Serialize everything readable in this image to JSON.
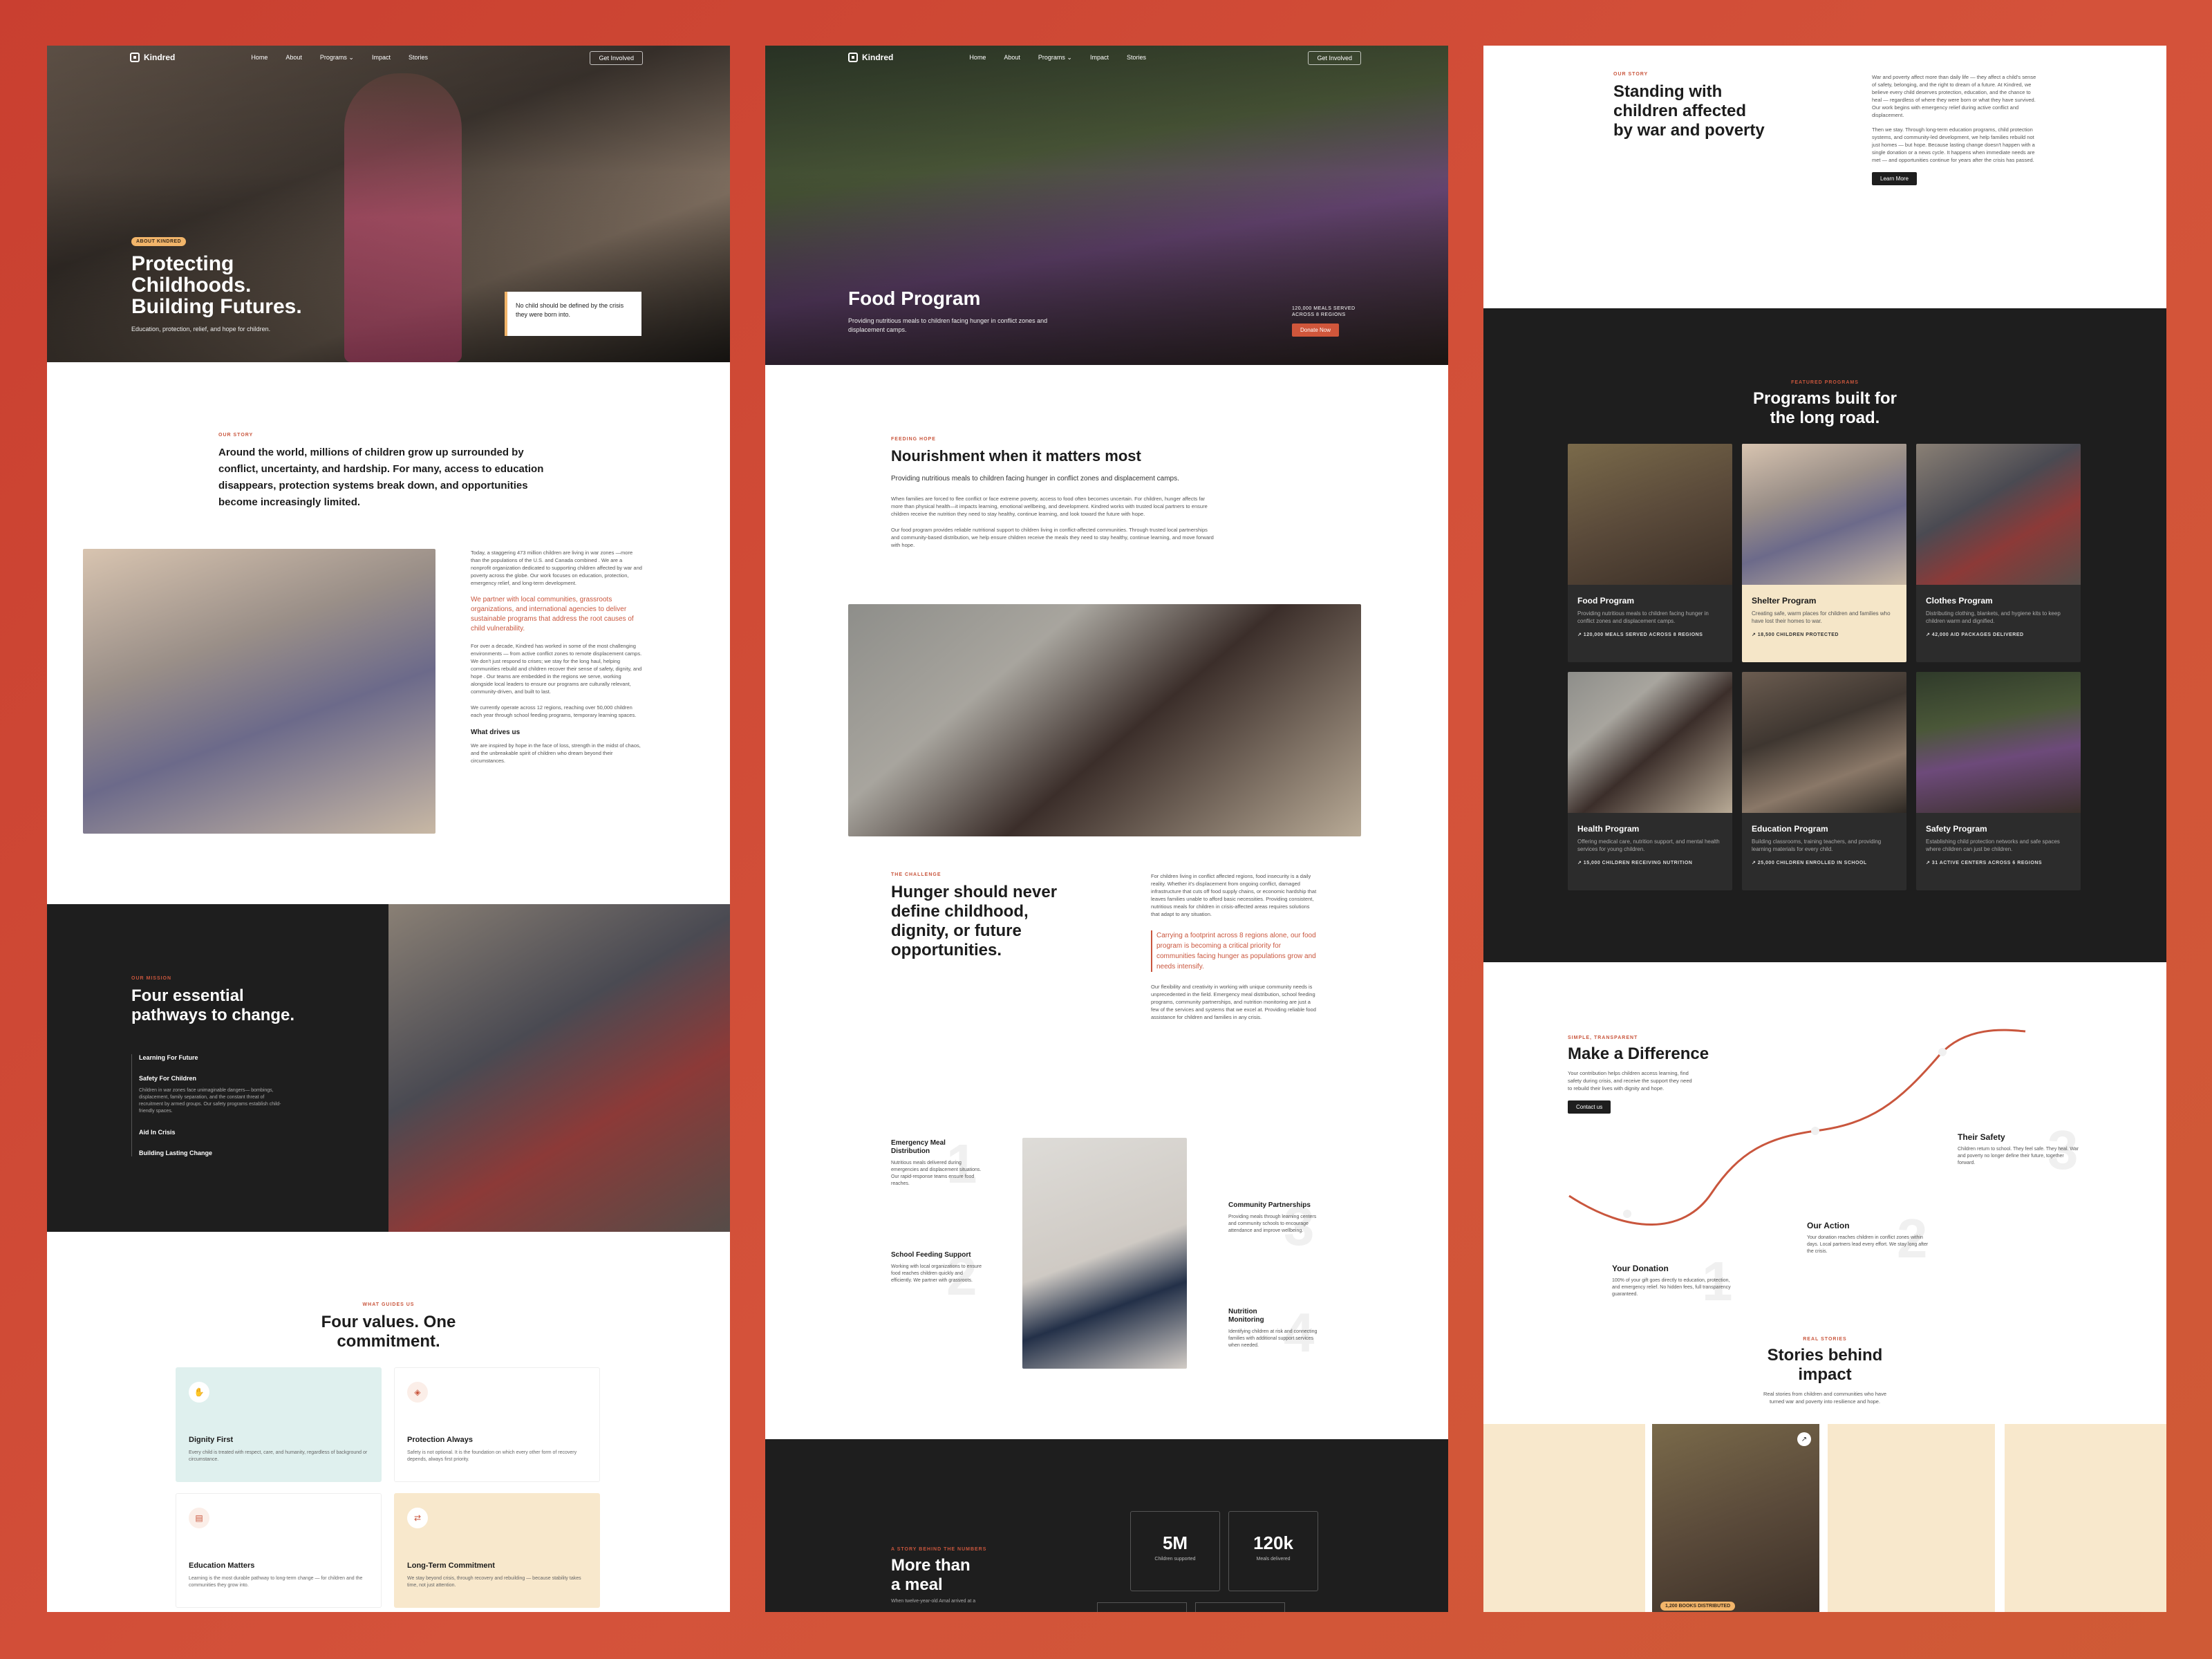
{
  "frame1": {
    "nav": {
      "logo": "Kindred",
      "links": [
        "Home",
        "About",
        "Programs",
        "Impact",
        "Stories"
      ],
      "cta": "Get Involved"
    },
    "hero": {
      "tag": "ABOUT KINDRED",
      "title_l1": "Protecting",
      "title_l2": "Childhoods.",
      "title_l3": "Building Futures.",
      "subtitle": "Education, protection, relief, and hope for children.",
      "quote": "No child should be defined by the crisis they were born into."
    },
    "story": {
      "eyebrow": "OUR STORY",
      "lead": "Around the world, millions of children grow up surrounded by conflict, uncertainty, and hardship. For many, access to education disappears, protection systems break down, and opportunities become increasingly limited.",
      "p1": "Today, a staggering 473 million children are living in war zones —more than the populations of the U.S. and Canada combined . We are a nonprofit organization dedicated to supporting children affected by war and poverty across the globe. Our work focuses on education, protection, emergency relief, and long-term development.",
      "highlight": "We partner with local communities, grassroots organizations, and international agencies to deliver sustainable programs that address the root causes of child vulnerability.",
      "p2": "For over a decade, Kindred has worked in some of the most challenging environments — from active conflict zones to remote displacement camps. We don't just respond to crises; we stay for the long haul, helping communities rebuild and children recover their sense of safety, dignity, and hope . Our teams are embedded in the regions we serve, working alongside local leaders to ensure our programs are culturally relevant, community-driven, and built to last.",
      "p3": "We currently operate across 12 regions, reaching over 50,000 children each year through school feeding programs, temporary learning spaces.",
      "drives_title": "What drives us",
      "p4": "We are inspired by hope in the face of loss, strength in the midst of chaos, and the unbreakable spirit of children who dream beyond their circumstances."
    },
    "mission": {
      "eyebrow": "OUR MISSION",
      "title_l1": "Four essential",
      "title_l2": "pathways to change.",
      "items": [
        "Learning For Future",
        "Safety For Children",
        "Aid In Crisis",
        "Building Lasting Change"
      ],
      "active_desc": "Children in war zones face unimaginable dangers— bombings, displacement, family separation, and the constant threat of recruitment by armed groups. Our safety programs establish child-friendly spaces."
    },
    "values": {
      "eyebrow": "WHAT GUIDES US",
      "title_l1": "Four values. One",
      "title_l2": "commitment.",
      "cards": [
        {
          "title": "Dignity First",
          "desc": "Every child is treated with respect, care, and humanity, regardless of background or circumstance.",
          "icon": "hand-icon",
          "color": "#dff0ee"
        },
        {
          "title": "Protection Always",
          "desc": "Safety is not optional. It is the foundation on which every other form of recovery depends, always first priority.",
          "icon": "shield-icon",
          "color": "#ffffff"
        },
        {
          "title": "Education Matters",
          "desc": "Learning is the most durable pathway to long-term change — for children and the communities they grow into.",
          "icon": "book-icon",
          "color": "#ffffff"
        },
        {
          "title": "Long-Term Commitment",
          "desc": "We stay beyond crisis, through recovery and rebuilding — because stability takes time, not just attention.",
          "icon": "handshake-icon",
          "color": "#f8e8cc"
        }
      ]
    }
  },
  "frame2": {
    "nav": {
      "logo": "Kindred",
      "links": [
        "Home",
        "About",
        "Programs",
        "Impact",
        "Stories"
      ],
      "cta": "Get Involved"
    },
    "hero": {
      "title": "Food Program",
      "subtitle": "Providing nutritious meals to children facing hunger in conflict zones and displacement camps.",
      "stat": "120,000 MEALS SERVED ACROSS 8 REGIONS",
      "cta": "Donate Now"
    },
    "intro": {
      "eyebrow": "FEEDING HOPE",
      "title": "Nourishment when it matters most",
      "lead": "Providing nutritious meals to children facing hunger in conflict zones and displacement camps.",
      "p1": "When families are forced to flee conflict or face extreme poverty, access to food often becomes uncertain. For children, hunger affects far more than physical health—it impacts learning, emotional wellbeing, and development. Kindred works with trusted local partners to ensure children receive the nutrition they need to stay healthy, continue learning, and look toward the future with hope.",
      "p2": "Our food program provides reliable nutritional support to children living in conflict-affected communities. Through trusted local partnerships and community-based distribution, we help ensure children receive the meals they need to stay healthy, continue learning, and move forward with hope."
    },
    "challenge": {
      "eyebrow": "THE CHALLENGE",
      "title_l1": "Hunger should never",
      "title_l2": "define childhood,",
      "title_l3": "dignity, or future",
      "title_l4": "opportunities.",
      "p1": "For children living in conflict affected regions, food insecurity is a daily reality. Whether it's displacement from ongoing conflict, damaged infrastructure that cuts off food supply chains, or economic hardship that leaves families unable to afford basic necessities. Providing consistent, nutritious meals for children in crisis-affected areas requires solutions that adapt to any situation.",
      "highlight": "Carrying a footprint across 8 regions alone, our food program is becoming a critical priority for communities facing hunger as populations grow and needs intensify.",
      "p2": "Our flexibility and creativity in working with unique community needs is unprecedented in the field. Emergency meal distribution, school feeding programs, community partnerships, and nutrition monitoring are just a few of the services and systems that we excel at. Providing reliable food assistance for children and families in any crisis."
    },
    "steps": [
      {
        "title": "Emergency Meal Distribution",
        "desc": "Nutritious meals delivered during emergencies and displacement situations. Our rapid-response teams ensure food reaches.",
        "num": "1"
      },
      {
        "title": "School Feeding Support",
        "desc": "Working with local organizations to ensure food reaches children quickly and efficiently. We partner with grassroots.",
        "num": "2"
      },
      {
        "title": "Community Partnerships",
        "desc": "Providing meals through learning centers and community schools to encourage attendance and improve wellbeing.",
        "num": "3"
      },
      {
        "title": "Nutrition Monitoring",
        "desc": "Identifying children at risk and connecting families with additional support services when needed.",
        "num": "4"
      }
    ],
    "numbers": {
      "eyebrow": "A STORY BEHIND THE NUMBERS",
      "title_l1": "More than",
      "title_l2": "a meal",
      "desc": "When twelve-year-old Amal arrived at a",
      "stats": [
        {
          "n": "5M",
          "l": "Children supported"
        },
        {
          "n": "120k",
          "l": "Meals delivered"
        }
      ]
    }
  },
  "frame3": {
    "story": {
      "eyebrow": "OUR STORY",
      "title_l1": "Standing with",
      "title_l2": "children affected",
      "title_l3": "by war and poverty",
      "p1": "War and poverty affect more than daily life — they affect a child's sense of safety, belonging, and the right to dream of a future. At Kindred, we believe every child deserves protection, education, and the chance to heal — regardless of where they were born or what they have survived. Our work begins with emergency relief during active conflict and displacement.",
      "p2": "Then we stay. Through long-term education programs, child protection systems, and community-led development, we help families rebuild not just homes — but hope. Because lasting change doesn't happen with a single donation or a news cycle. It happens when immediate needs are met — and opportunities continue for years after the crisis has passed.",
      "cta": "Learn More"
    },
    "programs": {
      "eyebrow": "FEATURED PROGRAMS",
      "title_l1": "Programs built for",
      "title_l2": "the long road.",
      "cards": [
        {
          "title": "Food Program",
          "desc": "Providing nutritious meals to children facing hunger in conflict zones and displacement camps.",
          "stat": "↗ 120,000 MEALS SERVED ACROSS 8 REGIONS"
        },
        {
          "title": "Shelter Program",
          "desc": "Creating safe, warm places for children and families who have lost their homes to war.",
          "stat": "↗ 18,500 CHILDREN PROTECTED"
        },
        {
          "title": "Clothes Program",
          "desc": "Distributing clothing, blankets, and hygiene kits to keep children warm and dignified.",
          "stat": "↗ 42,000 AID PACKAGES DELIVERED"
        },
        {
          "title": "Health Program",
          "desc": "Offering medical care, nutrition support, and mental health services for young children.",
          "stat": "↗ 15,000 CHILDREN RECEIVING NUTRITION"
        },
        {
          "title": "Education Program",
          "desc": "Building classrooms, training teachers, and providing learning materials for every child.",
          "stat": "↗ 25,000 CHILDREN ENROLLED IN SCHOOL"
        },
        {
          "title": "Safety Program",
          "desc": "Establishing child protection networks and safe spaces where children can just be children.",
          "stat": "↗ 31 ACTIVE CENTERS ACROSS 6 REGIONS"
        }
      ]
    },
    "difference": {
      "eyebrow": "SIMPLE, TRANSPARENT",
      "title": "Make a Difference",
      "desc": "Your contribution helps children access learning, find safety during crisis, and receive the support they need to rebuild their lives with dignity and hope.",
      "cta": "Contact us",
      "steps": [
        {
          "title": "Your Donation",
          "desc": "100% of your gift goes directly to education, protection, and emergency relief. No hidden fees, full transparency guaranteed.",
          "num": "1"
        },
        {
          "title": "Our Action",
          "desc": "Your donation reaches children in conflict zones within days. Local partners lead every effort. We stay long after the crisis.",
          "num": "2"
        },
        {
          "title": "Their Safety",
          "desc": "Children return to school. They feel safe. They heal. War and poverty no longer define their future, together forward.",
          "num": "3"
        }
      ]
    },
    "stories": {
      "eyebrow": "REAL STORIES",
      "title_l1": "Stories behind",
      "title_l2": "impact",
      "desc": "Real stories from children and communities who have turned war and poverty into resilience and hope.",
      "badge": "1,200 BOOKS DISTRIBUTED"
    }
  }
}
